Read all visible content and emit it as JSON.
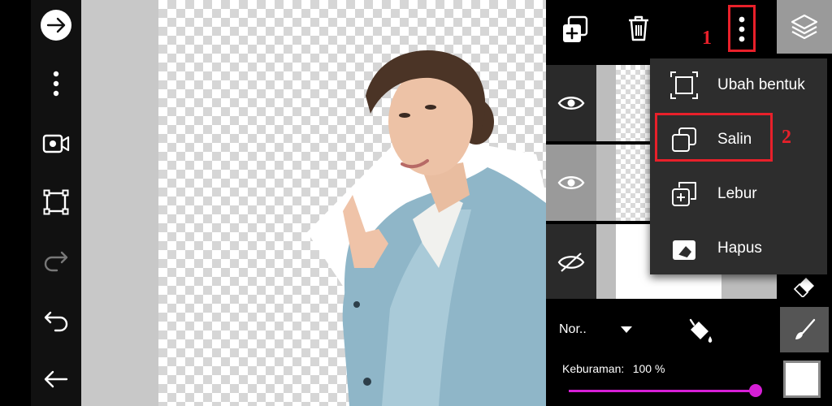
{
  "toolbar": {
    "icons": [
      "arrow-right-circle-icon",
      "more-vertical-icon",
      "video-camera-icon",
      "crop-frame-icon",
      "redo-icon",
      "undo-icon",
      "back-arrow-icon"
    ]
  },
  "layers_panel": {
    "header_icons": [
      "add-layer-icon",
      "trash-icon",
      "more-vertical-icon"
    ],
    "blend_mode": "Nor..",
    "opacity_label": "Keburaman:",
    "opacity_value": "100 %",
    "opacity_level": 1.0
  },
  "context_menu": {
    "items": [
      {
        "label": "Ubah bentuk",
        "icon": "transform-icon"
      },
      {
        "label": "Salin",
        "icon": "copy-icon"
      },
      {
        "label": "Lebur",
        "icon": "merge-icon"
      },
      {
        "label": "Hapus",
        "icon": "eraser-icon"
      }
    ]
  },
  "annotations": {
    "step1": "1",
    "step2": "2",
    "color": "#e8202a"
  },
  "colors": {
    "accent": "#d61fd6",
    "panel": "#000000",
    "menu": "#2d2d2d"
  }
}
